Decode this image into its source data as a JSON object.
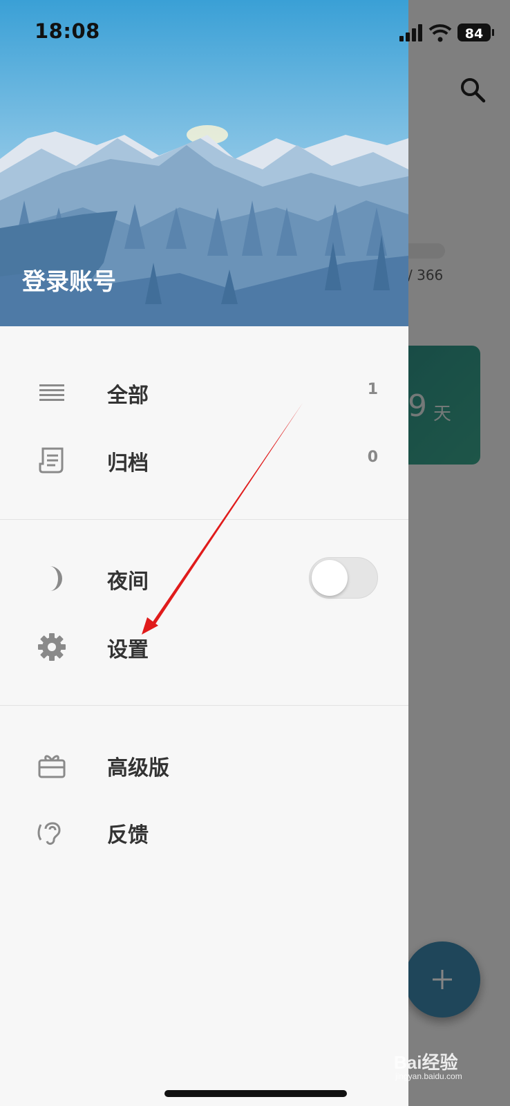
{
  "status_bar": {
    "time": "18:08",
    "battery": "84"
  },
  "drawer": {
    "header": {
      "login_label": "登录账号"
    },
    "menu": [
      {
        "label": "全部",
        "count": "1",
        "icon": "list-icon"
      },
      {
        "label": "归档",
        "count": "0",
        "icon": "archive-receipt-icon"
      }
    ],
    "night": {
      "label": "夜间",
      "enabled": false,
      "icon": "moon-icon"
    },
    "settings": {
      "label": "设置",
      "icon": "gear-icon"
    },
    "premium": {
      "label": "高级版",
      "icon": "gift-icon"
    },
    "feedback": {
      "label": "反馈",
      "icon": "ear-icon"
    }
  },
  "background_app": {
    "count_text": "/ 366",
    "card_number": "9",
    "card_unit": "天"
  },
  "watermark": {
    "text": "Bai经验",
    "url_text": "jingyan.baidu.com"
  },
  "colors": {
    "drawer_bg": "#f7f7f7",
    "card_accent": "#2d8f86",
    "fab": "#3d86ad",
    "annotation_arrow": "#e01b1b"
  }
}
